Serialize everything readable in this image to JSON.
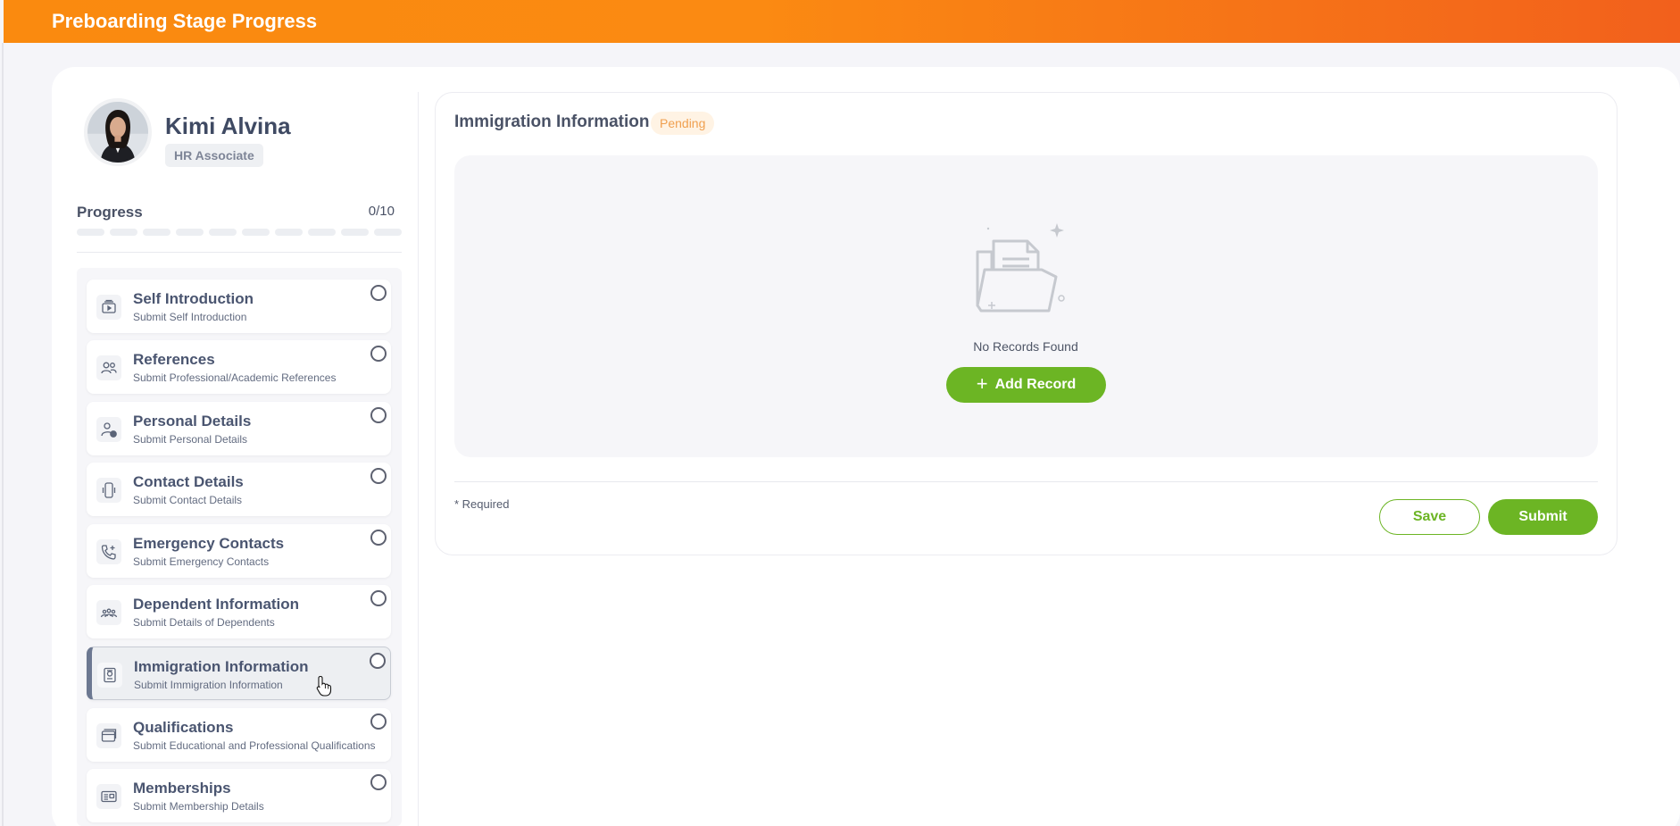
{
  "header": {
    "title": "Preboarding Stage Progress"
  },
  "profile": {
    "name": "Kimi Alvina",
    "role": "HR Associate",
    "avatar_icon": "user-photo"
  },
  "progress": {
    "label": "Progress",
    "count": "0/10",
    "completed": 0,
    "total": 10
  },
  "steps": [
    {
      "title": "Self Introduction",
      "subtitle": "Submit Self Introduction",
      "icon": "video-icon"
    },
    {
      "title": "References",
      "subtitle": "Submit Professional/Academic References",
      "icon": "people-icon"
    },
    {
      "title": "Personal Details",
      "subtitle": "Submit Personal Details",
      "icon": "user-info-icon"
    },
    {
      "title": "Contact Details",
      "subtitle": "Submit Contact Details",
      "icon": "phone-icon"
    },
    {
      "title": "Emergency Contacts",
      "subtitle": "Submit Emergency Contacts",
      "icon": "phone-plus-icon"
    },
    {
      "title": "Dependent Information",
      "subtitle": "Submit Details of Dependents",
      "icon": "family-icon"
    },
    {
      "title": "Immigration Information",
      "subtitle": "Submit Immigration Information",
      "icon": "passport-icon",
      "active": true
    },
    {
      "title": "Qualifications",
      "subtitle": "Submit Educational and Professional Qualifications",
      "icon": "cards-icon"
    },
    {
      "title": "Memberships",
      "subtitle": "Submit Membership Details",
      "icon": "id-card-icon"
    }
  ],
  "panel": {
    "title": "Immigration Information",
    "status": "Pending",
    "empty_text": "No Records Found",
    "add_label": "Add Record",
    "required_note": "* Required",
    "save_label": "Save",
    "submit_label": "Submit"
  },
  "colors": {
    "accent_green": "#6cb524",
    "header_orange": "#fa8a0f",
    "header_red_orange": "#f2601c",
    "pending_text": "#f0a050",
    "pending_bg": "#fff3e4"
  }
}
